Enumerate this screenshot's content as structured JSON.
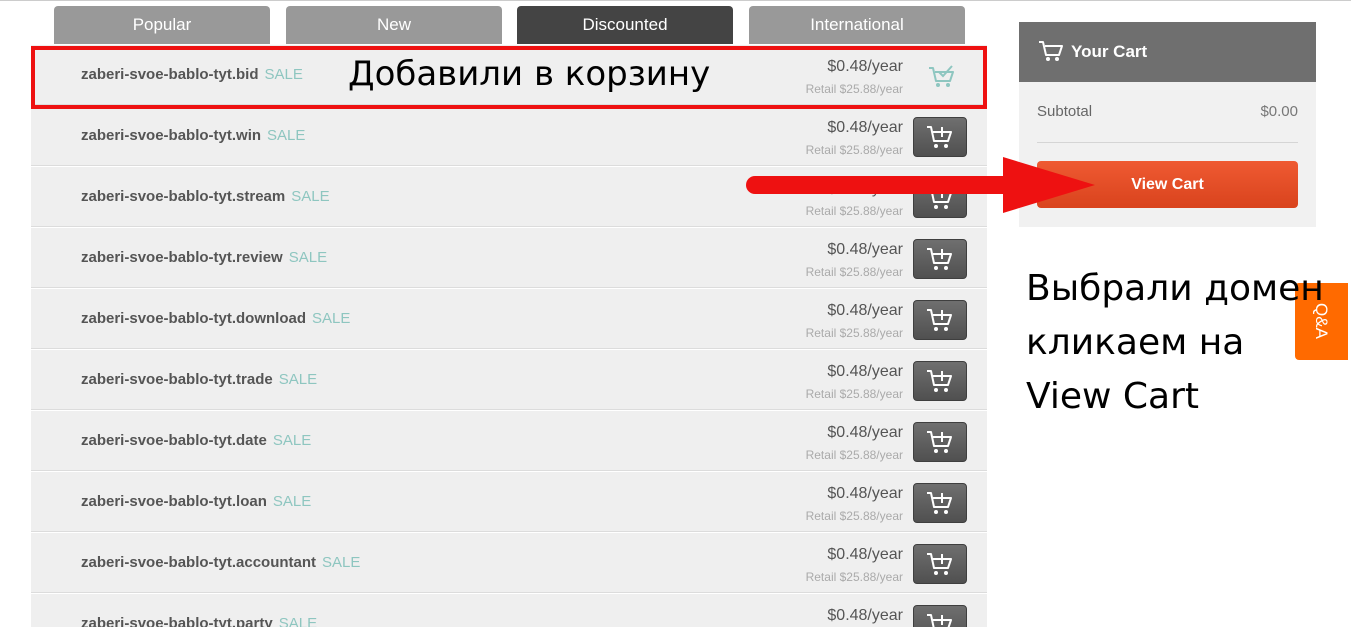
{
  "tabs": [
    "Popular",
    "New",
    "Discounted",
    "International"
  ],
  "active_tab": "Discounted",
  "sale_label": "SALE",
  "domains": [
    {
      "name": "zaberi-svoe-bablo-tyt.bid",
      "price": "$0.48/year",
      "retail": "Retail $25.88/year",
      "in_cart": true
    },
    {
      "name": "zaberi-svoe-bablo-tyt.win",
      "price": "$0.48/year",
      "retail": "Retail $25.88/year",
      "in_cart": false
    },
    {
      "name": "zaberi-svoe-bablo-tyt.stream",
      "price": "$0.48/year",
      "retail": "Retail $25.88/year",
      "in_cart": false
    },
    {
      "name": "zaberi-svoe-bablo-tyt.review",
      "price": "$0.48/year",
      "retail": "Retail $25.88/year",
      "in_cart": false
    },
    {
      "name": "zaberi-svoe-bablo-tyt.download",
      "price": "$0.48/year",
      "retail": "Retail $25.88/year",
      "in_cart": false
    },
    {
      "name": "zaberi-svoe-bablo-tyt.trade",
      "price": "$0.48/year",
      "retail": "Retail $25.88/year",
      "in_cart": false
    },
    {
      "name": "zaberi-svoe-bablo-tyt.date",
      "price": "$0.48/year",
      "retail": "Retail $25.88/year",
      "in_cart": false
    },
    {
      "name": "zaberi-svoe-bablo-tyt.loan",
      "price": "$0.48/year",
      "retail": "Retail $25.88/year",
      "in_cart": false
    },
    {
      "name": "zaberi-svoe-bablo-tyt.accountant",
      "price": "$0.48/year",
      "retail": "Retail $25.88/year",
      "in_cart": false
    },
    {
      "name": "zaberi-svoe-bablo-tyt.party",
      "price": "$0.48/year",
      "retail": "",
      "in_cart": false
    }
  ],
  "cart": {
    "title": "Your Cart",
    "subtotal_label": "Subtotal",
    "subtotal_value": "$0.00",
    "view_cart_label": "View Cart"
  },
  "annotations": {
    "added_to_cart": "Добавили в корзину",
    "instruction_lines": [
      "Выбрали домен",
      "кликаем на",
      "View Cart"
    ]
  },
  "qa_tab": "Q&A",
  "colors": {
    "accent": "#e8502a",
    "tab_inactive": "#999999",
    "tab_active": "#444444",
    "sale": "#8ec6c0",
    "annotation_red": "#ee1111",
    "qa_orange": "#ff6a00"
  }
}
